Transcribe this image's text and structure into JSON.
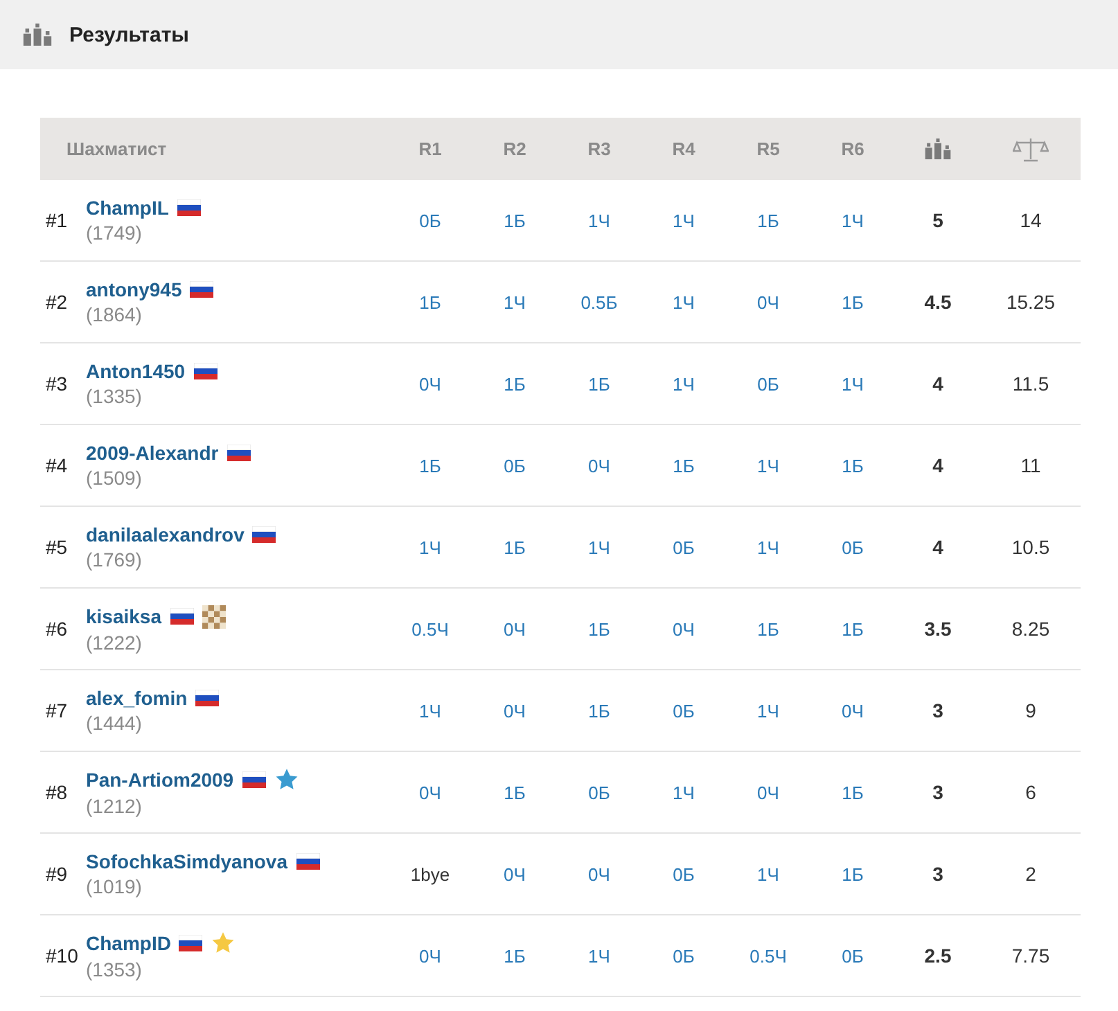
{
  "header": {
    "title": "Результаты"
  },
  "table": {
    "columns": [
      {
        "kind": "text",
        "label": "Шахматист"
      },
      {
        "kind": "text",
        "label": "R1"
      },
      {
        "kind": "text",
        "label": "R2"
      },
      {
        "kind": "text",
        "label": "R3"
      },
      {
        "kind": "text",
        "label": "R4"
      },
      {
        "kind": "text",
        "label": "R5"
      },
      {
        "kind": "text",
        "label": "R6"
      },
      {
        "kind": "points"
      },
      {
        "kind": "tiebreak"
      }
    ],
    "rows": [
      {
        "place": "#1",
        "name": "ChampIL",
        "rating": "(1749)",
        "badges": [
          {
            "kind": "flag"
          }
        ],
        "results": [
          {
            "kind": "game",
            "text": "0Б"
          },
          {
            "kind": "game",
            "text": "1Б"
          },
          {
            "kind": "game",
            "text": "1Ч"
          },
          {
            "kind": "game",
            "text": "1Ч"
          },
          {
            "kind": "game",
            "text": "1Б"
          },
          {
            "kind": "game",
            "text": "1Ч"
          }
        ],
        "points": "5",
        "tiebreak": "14"
      },
      {
        "place": "#2",
        "name": "antony945",
        "rating": "(1864)",
        "badges": [
          {
            "kind": "flag"
          }
        ],
        "results": [
          {
            "kind": "game",
            "text": "1Б"
          },
          {
            "kind": "game",
            "text": "1Ч"
          },
          {
            "kind": "game",
            "text": "0.5Б"
          },
          {
            "kind": "game",
            "text": "1Ч"
          },
          {
            "kind": "game",
            "text": "0Ч"
          },
          {
            "kind": "game",
            "text": "1Б"
          }
        ],
        "points": "4.5",
        "tiebreak": "15.25"
      },
      {
        "place": "#3",
        "name": "Anton1450",
        "rating": "(1335)",
        "badges": [
          {
            "kind": "flag"
          }
        ],
        "results": [
          {
            "kind": "game",
            "text": "0Ч"
          },
          {
            "kind": "game",
            "text": "1Б"
          },
          {
            "kind": "game",
            "text": "1Б"
          },
          {
            "kind": "game",
            "text": "1Ч"
          },
          {
            "kind": "game",
            "text": "0Б"
          },
          {
            "kind": "game",
            "text": "1Ч"
          }
        ],
        "points": "4",
        "tiebreak": "11.5"
      },
      {
        "place": "#4",
        "name": "2009-Alexandr",
        "rating": "(1509)",
        "badges": [
          {
            "kind": "flag"
          }
        ],
        "results": [
          {
            "kind": "game",
            "text": "1Б"
          },
          {
            "kind": "game",
            "text": "0Б"
          },
          {
            "kind": "game",
            "text": "0Ч"
          },
          {
            "kind": "game",
            "text": "1Б"
          },
          {
            "kind": "game",
            "text": "1Ч"
          },
          {
            "kind": "game",
            "text": "1Б"
          }
        ],
        "points": "4",
        "tiebreak": "11"
      },
      {
        "place": "#5",
        "name": "danilaalexandrov",
        "rating": "(1769)",
        "badges": [
          {
            "kind": "flag"
          }
        ],
        "results": [
          {
            "kind": "game",
            "text": "1Ч"
          },
          {
            "kind": "game",
            "text": "1Б"
          },
          {
            "kind": "game",
            "text": "1Ч"
          },
          {
            "kind": "game",
            "text": "0Б"
          },
          {
            "kind": "game",
            "text": "1Ч"
          },
          {
            "kind": "game",
            "text": "0Б"
          }
        ],
        "points": "4",
        "tiebreak": "10.5"
      },
      {
        "place": "#6",
        "name": "kisaiksa",
        "rating": "(1222)",
        "badges": [
          {
            "kind": "flag"
          },
          {
            "kind": "chess"
          }
        ],
        "results": [
          {
            "kind": "game",
            "text": "0.5Ч"
          },
          {
            "kind": "game",
            "text": "0Ч"
          },
          {
            "kind": "game",
            "text": "1Б"
          },
          {
            "kind": "game",
            "text": "0Ч"
          },
          {
            "kind": "game",
            "text": "1Б"
          },
          {
            "kind": "game",
            "text": "1Б"
          }
        ],
        "points": "3.5",
        "tiebreak": "8.25"
      },
      {
        "place": "#7",
        "name": "alex_fomin",
        "rating": "(1444)",
        "badges": [
          {
            "kind": "flag"
          }
        ],
        "results": [
          {
            "kind": "game",
            "text": "1Ч"
          },
          {
            "kind": "game",
            "text": "0Ч"
          },
          {
            "kind": "game",
            "text": "1Б"
          },
          {
            "kind": "game",
            "text": "0Б"
          },
          {
            "kind": "game",
            "text": "1Ч"
          },
          {
            "kind": "game",
            "text": "0Ч"
          }
        ],
        "points": "3",
        "tiebreak": "9"
      },
      {
        "place": "#8",
        "name": "Pan-Artiom2009",
        "rating": "(1212)",
        "badges": [
          {
            "kind": "flag"
          },
          {
            "kind": "star",
            "color": "#3a9bd0"
          }
        ],
        "results": [
          {
            "kind": "game",
            "text": "0Ч"
          },
          {
            "kind": "game",
            "text": "1Б"
          },
          {
            "kind": "game",
            "text": "0Б"
          },
          {
            "kind": "game",
            "text": "1Ч"
          },
          {
            "kind": "game",
            "text": "0Ч"
          },
          {
            "kind": "game",
            "text": "1Б"
          }
        ],
        "points": "3",
        "tiebreak": "6"
      },
      {
        "place": "#9",
        "name": "SofochkaSimdyanova",
        "rating": "(1019)",
        "badges": [
          {
            "kind": "flag"
          }
        ],
        "results": [
          {
            "kind": "bye",
            "text": "1bye"
          },
          {
            "kind": "game",
            "text": "0Ч"
          },
          {
            "kind": "game",
            "text": "0Ч"
          },
          {
            "kind": "game",
            "text": "0Б"
          },
          {
            "kind": "game",
            "text": "1Ч"
          },
          {
            "kind": "game",
            "text": "1Б"
          }
        ],
        "points": "3",
        "tiebreak": "2"
      },
      {
        "place": "#10",
        "name": "ChampID",
        "rating": "(1353)",
        "badges": [
          {
            "kind": "flag"
          },
          {
            "kind": "star",
            "color": "#f5c842"
          }
        ],
        "results": [
          {
            "kind": "game",
            "text": "0Ч"
          },
          {
            "kind": "game",
            "text": "1Б"
          },
          {
            "kind": "game",
            "text": "1Ч"
          },
          {
            "kind": "game",
            "text": "0Б"
          },
          {
            "kind": "game",
            "text": "0.5Ч"
          },
          {
            "kind": "game",
            "text": "0Б"
          }
        ],
        "points": "2.5",
        "tiebreak": "7.75"
      }
    ]
  }
}
